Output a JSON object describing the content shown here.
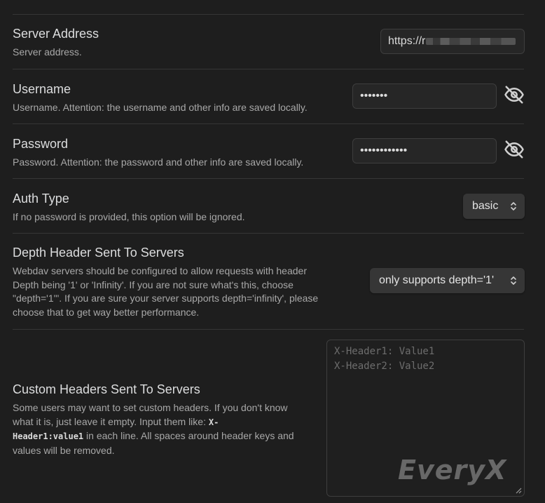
{
  "server_address": {
    "name": "Server Address",
    "desc": "Server address.",
    "value": "https://r"
  },
  "username": {
    "name": "Username",
    "desc": "Username. Attention: the username and other info are saved locally.",
    "value": "•••••••"
  },
  "password": {
    "name": "Password",
    "desc": "Password. Attention: the password and other info are saved locally.",
    "value": "••••••••••••"
  },
  "auth_type": {
    "name": "Auth Type",
    "desc": "If no password is provided, this option will be ignored.",
    "selected": "basic"
  },
  "depth_header": {
    "name": "Depth Header Sent To Servers",
    "desc_line1": "Webdav servers should be configured to allow requests with header",
    "desc_line2": "Depth being '1' or 'Infinity'. If you are not sure what's this, choose",
    "desc_line3": "\"depth='1'\". If you are sure your server supports depth='infinity', please",
    "desc_line4": "choose that to get way better performance.",
    "selected": "only supports depth='1'"
  },
  "custom_headers": {
    "name": "Custom Headers Sent To Servers",
    "desc_line1": "Some users may want to set custom headers. If you don't know",
    "desc_line2_pre": "what it is, just leave it empty. Input them like: ",
    "code_part1": "X-",
    "code_part2": "Header1:value1",
    "desc_line3_post": " in each line. All spaces around header keys and",
    "desc_line4": "values will be removed.",
    "placeholder_line1": "X-Header1: Value1",
    "placeholder_line2": "X-Header2: Value2"
  },
  "watermark": "EveryX",
  "icons": {
    "eye": "eye-off-icon",
    "select_chevron": "chevron-up-down-icon",
    "resize": "resize-handle-icon"
  }
}
